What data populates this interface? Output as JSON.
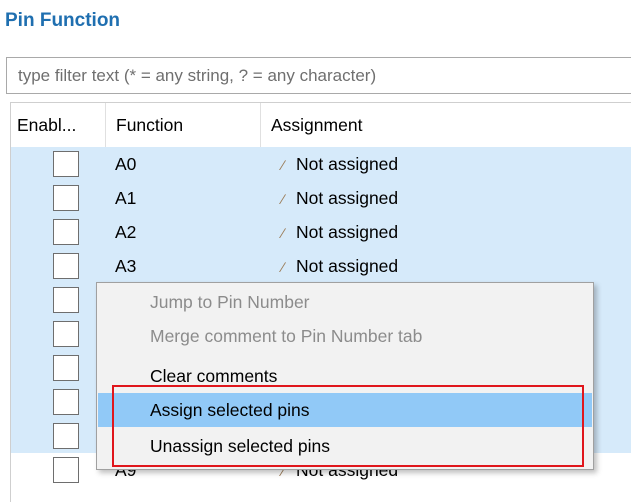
{
  "panel": {
    "title": "Pin Function"
  },
  "filter": {
    "placeholder": "type filter text (* = any string, ? = any character)"
  },
  "table": {
    "columns": [
      "Enabl...",
      "Function",
      "Assignment"
    ],
    "rows": [
      {
        "function": "A0",
        "assignment": "Not assigned"
      },
      {
        "function": "A1",
        "assignment": "Not assigned"
      },
      {
        "function": "A2",
        "assignment": "Not assigned"
      },
      {
        "function": "A3",
        "assignment": "Not assigned"
      },
      {
        "function": "",
        "assignment": ""
      },
      {
        "function": "",
        "assignment": ""
      },
      {
        "function": "",
        "assignment": ""
      },
      {
        "function": "",
        "assignment": ""
      },
      {
        "function": "",
        "assignment": ""
      },
      {
        "function": "A9",
        "assignment": "Not assigned"
      }
    ]
  },
  "context_menu": {
    "items": [
      {
        "label": "Jump to Pin Number",
        "state": "disabled"
      },
      {
        "label": "Merge comment to Pin Number tab",
        "state": "disabled"
      },
      {
        "label": "Clear comments",
        "state": "enabled"
      },
      {
        "label": "Assign selected pins",
        "state": "hover"
      },
      {
        "label": "Unassign selected pins",
        "state": "enabled"
      }
    ]
  },
  "colors": {
    "title": "#1f6fb0",
    "row_highlight": "#d6eafa",
    "menu_hover": "#91c9f7",
    "annotation_box": "#e0161c"
  },
  "icons": {
    "assignment": "pencil-icon"
  }
}
